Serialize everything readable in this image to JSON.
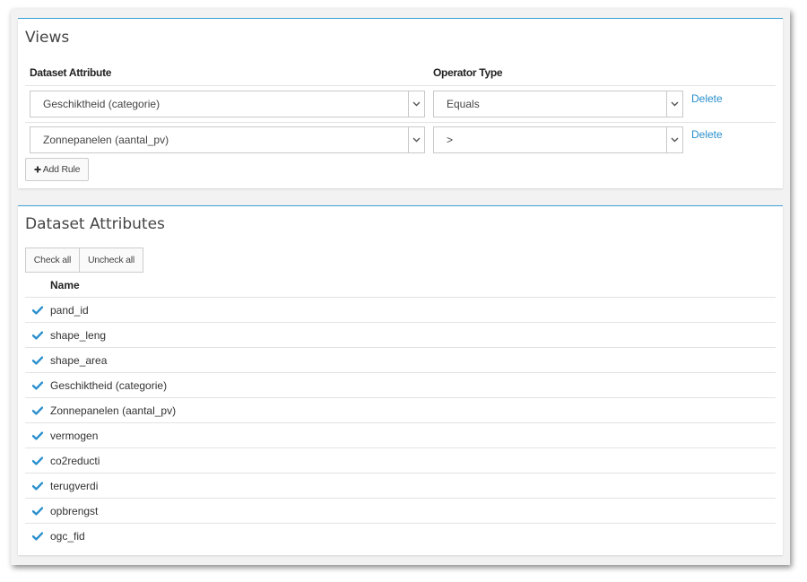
{
  "views": {
    "title": "Views",
    "columns": {
      "attribute": "Dataset Attribute",
      "operator": "Operator Type"
    },
    "rules": [
      {
        "attribute": "Geschiktheid (categorie)",
        "operator": "Equals",
        "delete_label": "Delete"
      },
      {
        "attribute": "Zonnepanelen (aantal_pv)",
        "operator": ">",
        "delete_label": "Delete"
      }
    ],
    "add_rule_label": "Add Rule"
  },
  "attributes": {
    "title": "Dataset Attributes",
    "check_all_label": "Check all",
    "uncheck_all_label": "Uncheck all",
    "name_header": "Name",
    "items": [
      {
        "name": "pand_id",
        "checked": true
      },
      {
        "name": "shape_leng",
        "checked": true
      },
      {
        "name": "shape_area",
        "checked": true
      },
      {
        "name": "Geschiktheid (categorie)",
        "checked": true
      },
      {
        "name": "Zonnepanelen (aantal_pv)",
        "checked": true
      },
      {
        "name": "vermogen",
        "checked": true
      },
      {
        "name": "co2reducti",
        "checked": true
      },
      {
        "name": "terugverdi",
        "checked": true
      },
      {
        "name": "opbrengst",
        "checked": true
      },
      {
        "name": "ogc_fid",
        "checked": true
      }
    ]
  },
  "colors": {
    "accent": "#3c9fd6",
    "link": "#2a8fcc",
    "check": "#2a8fcc"
  }
}
